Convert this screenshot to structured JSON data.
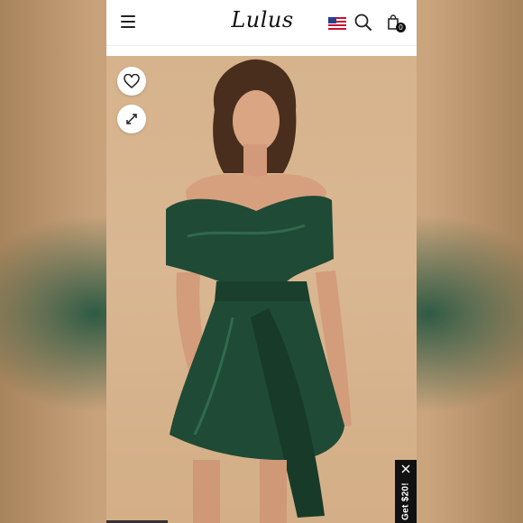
{
  "header": {
    "logo": "Lulus",
    "menu_icon": "hamburger-menu-icon",
    "flag_icon": "us-flag-icon",
    "search_icon": "search-icon",
    "bag_icon": "shopping-bag-icon",
    "bag_count": "0"
  },
  "product": {
    "wishlist_icon": "heart-icon",
    "expand_icon": "expand-arrows-icon",
    "dress_color": "#1f4a35"
  },
  "promo": {
    "label": "Get $20!",
    "close_icon": "close-icon"
  },
  "colors": {
    "backdrop": "#c7a27a",
    "photo_background": "#d6b38c",
    "promo_bg": "#111111"
  }
}
